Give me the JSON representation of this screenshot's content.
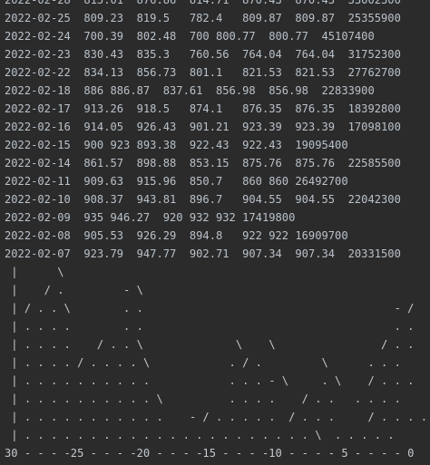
{
  "console": {
    "rows": [
      "2022-02-28  815.01  876.86  814.71  870.43  870.43  33002300",
      "2022-02-25  809.23  819.5   782.4   809.87  809.87  25355900",
      "2022-02-24  700.39  802.48  700 800.77  800.77  45107400",
      "2022-02-23  830.43  835.3   760.56  764.04  764.04  31752300",
      "2022-02-22  834.13  856.73  801.1   821.53  821.53  27762700",
      "2022-02-18  886 886.87  837.61  856.98  856.98  22833900",
      "2022-02-17  913.26  918.5   874.1   876.35  876.35  18392800",
      "2022-02-16  914.05  926.43  901.21  923.39  923.39  17098100",
      "2022-02-15  900 923 893.38  922.43  922.43  19095400",
      "2022-02-14  861.57  898.88  853.15  875.76  875.76  22585500",
      "2022-02-11  909.63  915.96  850.7   860 860 26492700",
      "2022-02-10  908.37  943.81  896.7   904.55  904.55  22042300",
      "2022-02-09  935 946.27  920 932 932 17419800",
      "2022-02-08  905.53  926.29  894.8   922 922 16909700",
      "2022-02-07  923.79  947.77  902.71  907.34  907.34  20331500"
    ],
    "plot": [
      " |      \\",
      " |    / .         - \\",
      " | / . . \\        . .                                      - /",
      " | . . . .        . .                                      . .",
      " | . . . .    / . . \\              \\    \\                / . .",
      " | . . . . / . . . . \\            . / .         \\      . . .",
      " | . . . . . . . . . .            . . . - \\     . \\    / . . .",
      " | . . . . . . . . . . \\          . . . .    / . .   . . . .",
      " | . . . . . . . . . . .    - / . . . . .  / . . .     / . . . .",
      " | . . . . . . . . . . . . . . . . . . . . . . \\  . . . . .",
      "30 - - - -25 - - - -20 - - - -15 - - - -10 - - - - 5 - - - - 0"
    ]
  }
}
